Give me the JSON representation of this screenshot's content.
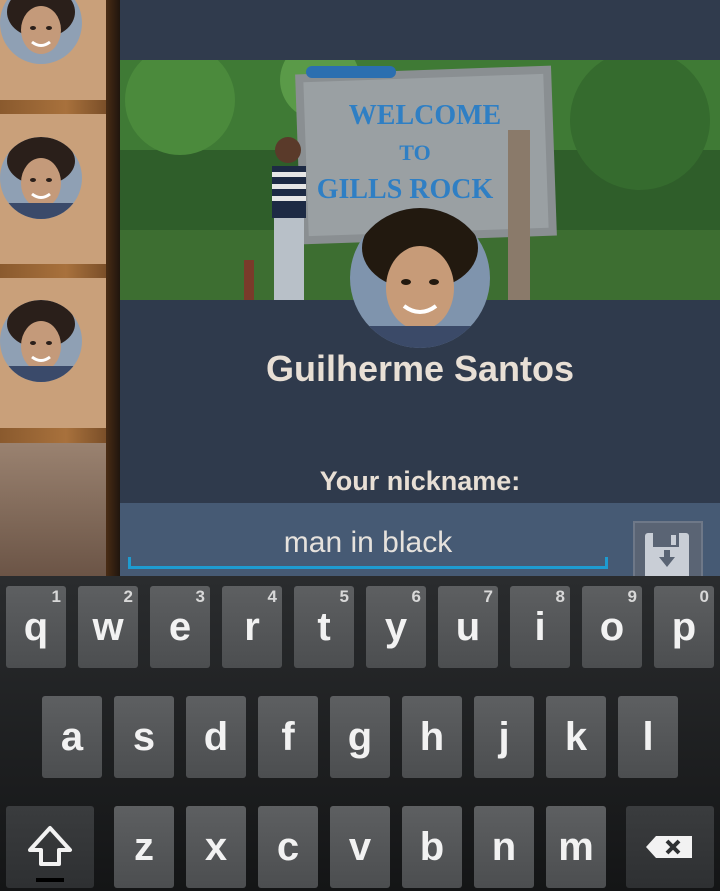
{
  "profile": {
    "name": "Guilherme Santos",
    "cover_sign_text": [
      "WELCOME",
      "TO",
      "GILLS ROCK"
    ]
  },
  "nickname": {
    "label": "Your nickname:",
    "value": "man in black",
    "save_icon": "floppy-save-icon"
  },
  "contacts": {
    "items": [
      {
        "avatar": "profile-photo"
      },
      {
        "avatar": "profile-photo"
      },
      {
        "avatar": "profile-photo"
      }
    ]
  },
  "keyboard": {
    "row1": [
      {
        "label": "q",
        "num": "1"
      },
      {
        "label": "w",
        "num": "2"
      },
      {
        "label": "e",
        "num": "3"
      },
      {
        "label": "r",
        "num": "4"
      },
      {
        "label": "t",
        "num": "5"
      },
      {
        "label": "y",
        "num": "6"
      },
      {
        "label": "u",
        "num": "7"
      },
      {
        "label": "i",
        "num": "8"
      },
      {
        "label": "o",
        "num": "9"
      },
      {
        "label": "p",
        "num": "0"
      }
    ],
    "row2": [
      "a",
      "s",
      "d",
      "f",
      "g",
      "h",
      "j",
      "k",
      "l"
    ],
    "row3": [
      "z",
      "x",
      "c",
      "v",
      "b",
      "n",
      "m"
    ],
    "shift_icon": "shift-icon",
    "backspace_icon": "backspace-icon"
  },
  "colors": {
    "panel": "#2f3a4c",
    "nick_bar": "#465a74",
    "accent": "#1e9bd0",
    "text": "#e8dfd5"
  }
}
